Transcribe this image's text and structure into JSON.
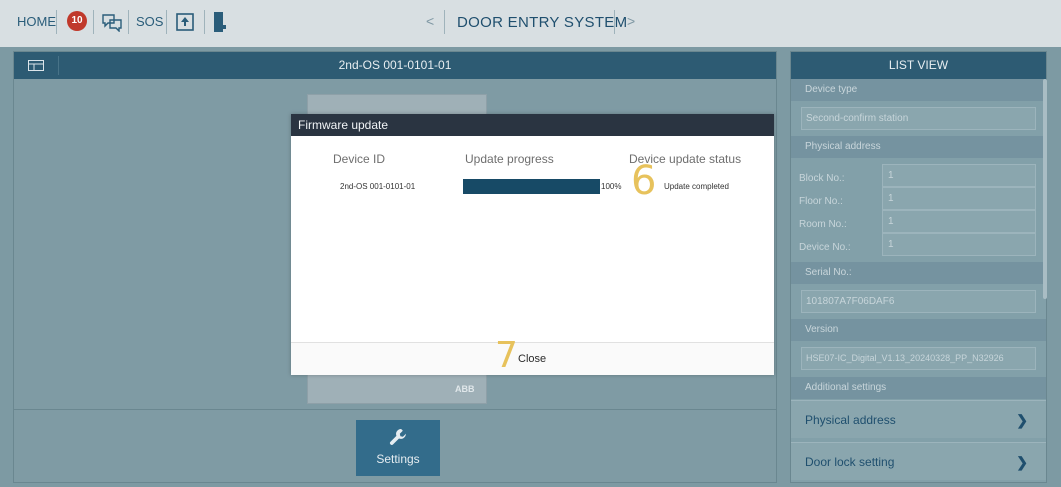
{
  "topbar": {
    "home_label": "HOME",
    "badge_count": "10",
    "sos_label": "SOS",
    "nav_prev": "<",
    "title": "DOOR ENTRY SYSTEM",
    "nav_next": ">"
  },
  "main": {
    "panel_title": "2nd-OS 001-0101-01",
    "device_logo": "ABB",
    "settings_label": "Settings"
  },
  "list_view": {
    "title": "LIST VIEW",
    "device_type_label": "Device type",
    "device_type_value": "Second-confirm station",
    "physical_address_label": "Physical address",
    "block_label": "Block No.:",
    "block_value": "1",
    "floor_label": "Floor No.:",
    "floor_value": "1",
    "room_label": "Room No.:",
    "room_value": "1",
    "device_label": "Device No.:",
    "device_value": "1",
    "serial_label": "Serial No.:",
    "serial_value": "101807A7F06DAF6",
    "version_label": "Version",
    "version_value": "HSE07-IC_Digital_V1.13_20240328_PP_N32926",
    "additional_label": "Additional settings",
    "link_physical_address": "Physical address",
    "link_door_lock": "Door lock setting"
  },
  "modal": {
    "title": "Firmware update",
    "col_device_id": "Device ID",
    "col_progress": "Update progress",
    "col_status": "Device update status",
    "row_device_id": "2nd-OS 001-0101-01",
    "row_progress": 1.0,
    "row_progress_label": "100%",
    "row_status": "Update completed",
    "close_label": "Close"
  },
  "callouts": {
    "six": "6",
    "seven": "7"
  },
  "colors": {
    "accent": "#174a66",
    "header": "#2d5b73",
    "callout": "#e7c25c"
  }
}
